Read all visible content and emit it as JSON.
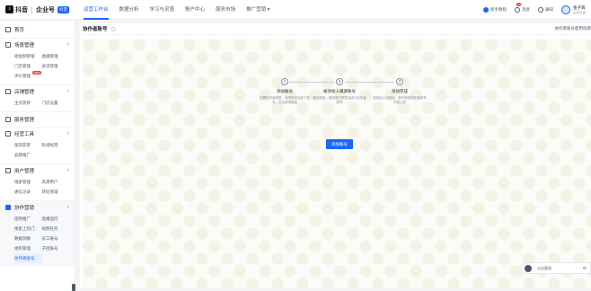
{
  "app": {
    "logo_mark": "♪",
    "logo_name": "抖音",
    "logo_product": "企业号",
    "logo_badge": "抖音"
  },
  "nav": {
    "items": [
      {
        "label": "运营工作台",
        "active": true
      },
      {
        "label": "数据分析"
      },
      {
        "label": "学习与灵感"
      },
      {
        "label": "账户中心"
      },
      {
        "label": "服务市场"
      },
      {
        "label": "推广营销 ▾"
      }
    ]
  },
  "topright": {
    "new_manual": "新手教程",
    "messages": "消息",
    "messages_count": "1",
    "bell": "通知",
    "user_name": "金子辉",
    "user_sub": "企业认证"
  },
  "sidebar": {
    "home": "首页",
    "groups": [
      {
        "title": "场景管理",
        "items": [
          "短视频管理",
          "直播管理",
          "门店管理",
          "会话管理",
          "评价管理"
        ]
      },
      {
        "title": "店铺管理",
        "items": [
          "主页装修",
          "门店设置"
        ]
      },
      {
        "title": "服务管理",
        "items": []
      },
      {
        "title": "经营工具",
        "items": [
          "留资获客",
          "私域经营",
          "品牌推广"
        ]
      },
      {
        "title": "用户管理",
        "items": [
          "线索管理",
          "高潜用户",
          "通信记录",
          "转化管理"
        ]
      },
      {
        "title": "协作营销",
        "items": [
          "团购推广",
          "直播监控",
          "搜索上热门",
          "视频任务",
          "数据洞察",
          "员工账号",
          "组织管理",
          "子团账号",
          "协作者账号"
        ]
      }
    ],
    "new_badge": "NEW"
  },
  "main": {
    "title": "协作者账号",
    "help_link": "协作者账号使用指南",
    "steps": [
      {
        "num": "1",
        "title": "添加账号",
        "desc": "设置协作者类型，可同时添加多个账号，发出邀请链接"
      },
      {
        "num": "2",
        "title": "被添加人邀请账号",
        "desc": "通过链接，被邀请方同意后成为协作者账号"
      },
      {
        "num": "3",
        "title": "添加完成",
        "desc": "被添加人完成后，即可使用协作者账号开展工作"
      }
    ],
    "add_button": "添加账号"
  },
  "float_bar": {
    "label": "点击登录",
    "minimize": "⊖"
  },
  "colors": {
    "accent": "#1966ff",
    "badge": "#f53f3f"
  }
}
